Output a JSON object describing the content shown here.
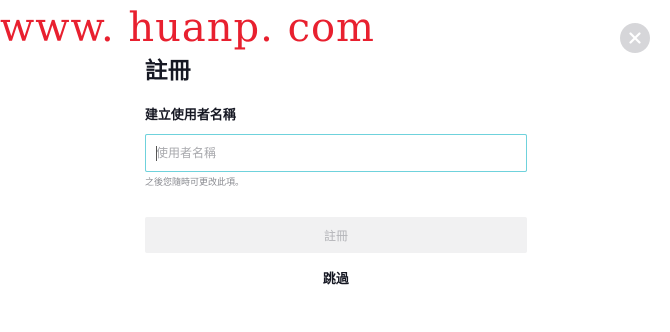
{
  "watermark": {
    "text": "www. huanp. com"
  },
  "dialog": {
    "title": "註冊",
    "username_label": "建立使用者名稱",
    "username_input": {
      "placeholder": "使用者名稱",
      "value": ""
    },
    "hint": "之後您隨時可更改此項。",
    "submit_label": "註冊",
    "skip_label": "跳過",
    "close_icon": "close-icon"
  },
  "colors": {
    "watermark": "#e8202f",
    "input_focus_border": "#6fd2dc",
    "submit_disabled_bg": "#f1f1f2",
    "submit_disabled_text": "#b3b4b8",
    "close_button_bg": "#d6d6d9"
  }
}
